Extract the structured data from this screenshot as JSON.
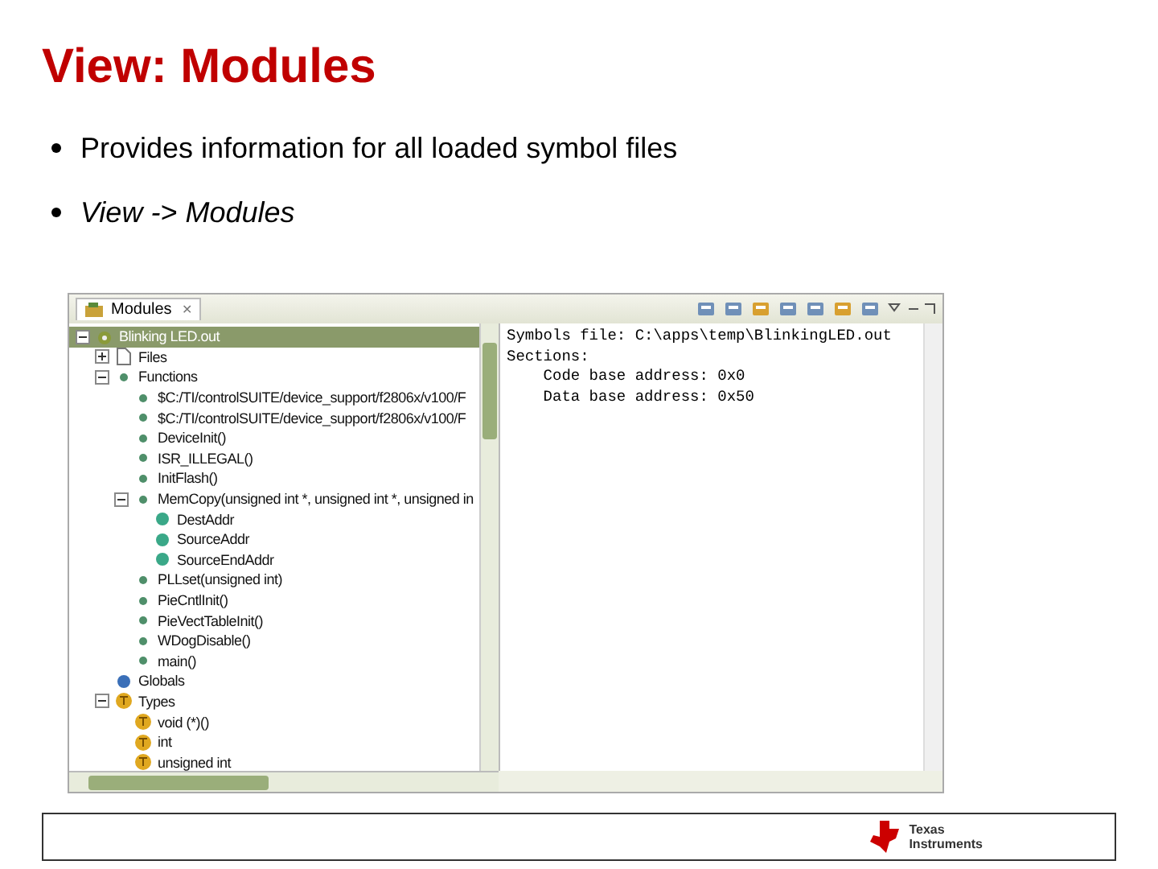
{
  "title": "View: Modules",
  "bullets": [
    {
      "text": "Provides information for all loaded symbol files",
      "kind": "plain"
    },
    {
      "text": "View -> Modules",
      "kind": "italic"
    }
  ],
  "window": {
    "tab": "Modules",
    "close": "✕",
    "tree": [
      {
        "label": "Blinking LED.out",
        "kind": "module",
        "expanded": true,
        "selected": true,
        "children": [
          {
            "label": "Files",
            "kind": "file",
            "expanded": false,
            "selected": false
          },
          {
            "label": "Functions",
            "kind": "function",
            "expanded": true,
            "selected": false,
            "children": [
              {
                "label": "$C:/TI/controlSUITE/device_support/f2806x/v100/F",
                "kind": "function",
                "selected": false
              },
              {
                "label": "$C:/TI/controlSUITE/device_support/f2806x/v100/F",
                "kind": "function",
                "selected": false
              },
              {
                "label": "DeviceInit()",
                "kind": "function",
                "selected": false
              },
              {
                "label": "ISR_ILLEGAL()",
                "kind": "function",
                "selected": false
              },
              {
                "label": "InitFlash()",
                "kind": "function",
                "selected": false
              },
              {
                "label": "MemCopy(unsigned int *, unsigned int *, unsigned in",
                "kind": "function",
                "expanded": true,
                "selected": false,
                "children": [
                  {
                    "label": "DestAddr",
                    "kind": "param",
                    "selected": false
                  },
                  {
                    "label": "SourceAddr",
                    "kind": "param",
                    "selected": false
                  },
                  {
                    "label": "SourceEndAddr",
                    "kind": "param",
                    "selected": false
                  }
                ]
              },
              {
                "label": "PLLset(unsigned int)",
                "kind": "function",
                "selected": false
              },
              {
                "label": "PieCntlInit()",
                "kind": "function",
                "selected": false
              },
              {
                "label": "PieVectTableInit()",
                "kind": "function",
                "selected": false
              },
              {
                "label": "WDogDisable()",
                "kind": "function",
                "selected": false
              },
              {
                "label": "main()",
                "kind": "function",
                "selected": false
              }
            ]
          },
          {
            "label": "Globals",
            "kind": "global",
            "selected": false
          },
          {
            "label": "Types",
            "kind": "type",
            "expanded": true,
            "selected": false,
            "children": [
              {
                "label": "void (*)()",
                "kind": "type",
                "selected": false
              },
              {
                "label": "int",
                "kind": "type",
                "selected": false
              },
              {
                "label": "unsigned int",
                "kind": "type",
                "selected": false
              }
            ]
          }
        ]
      }
    ],
    "details": [
      "Symbols file: C:\\apps\\temp\\BlinkingLED.out",
      "Sections:",
      "    Code base address: 0x0",
      "    Data base address: 0x50"
    ]
  },
  "footer": {
    "logo_top": "Texas",
    "logo_bottom": "Instruments"
  }
}
